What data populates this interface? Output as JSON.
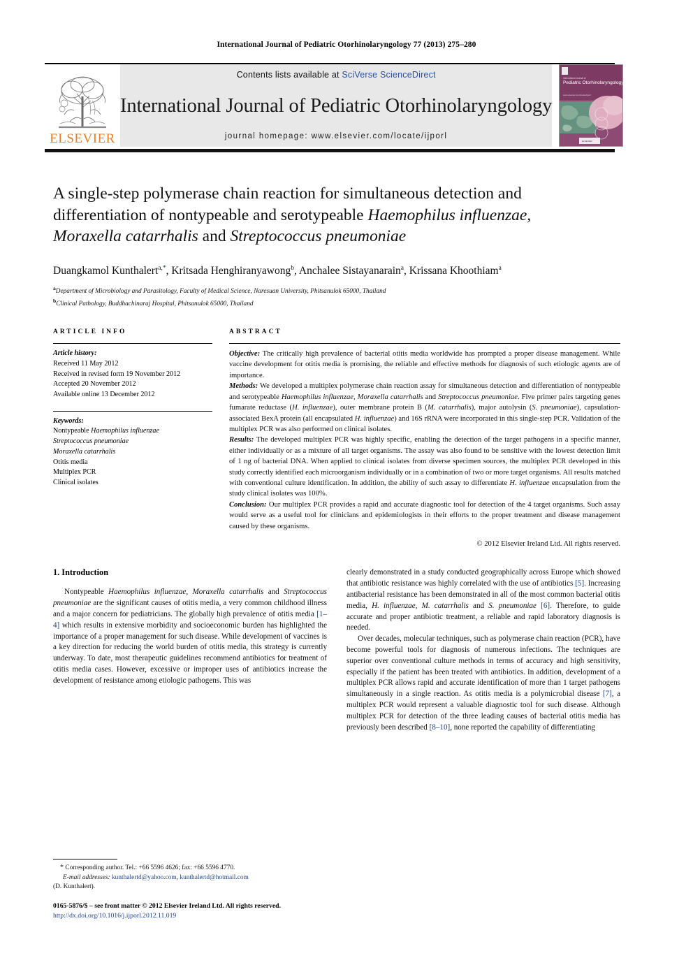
{
  "running_head": "International Journal of Pediatric Otorhinolaryngology 77 (2013) 275–280",
  "masthead": {
    "contents_prefix": "Contents lists available at ",
    "contents_link": "SciVerse ScienceDirect",
    "journal_title": "International Journal of Pediatric Otorhinolaryngology",
    "homepage": "journal homepage: www.elsevier.com/locate/ijporl",
    "publisher": "ELSEVIER",
    "publisher_color": "#ef7d22",
    "cover_title": "Pediatric Otorhinolaryngology",
    "cover_color": "#7d3b63"
  },
  "title": {
    "line1": "A single-step polymerase chain reaction for simultaneous detection and",
    "line2_a": "differentiation of nontypeable and serotypeable ",
    "line2_i": "Haemophilus influenzae,",
    "line3_i1": "Moraxella catarrhalis",
    "line3_a": " and ",
    "line3_i2": "Streptococcus pneumoniae"
  },
  "authors": [
    {
      "name": "Duangkamol Kunthalert",
      "marks": "a,",
      "star": "*"
    },
    {
      "name": "Kritsada Henghiranyawong",
      "marks": "b",
      "star": ""
    },
    {
      "name": "Anchalee Sistayanarain",
      "marks": "a",
      "star": ""
    },
    {
      "name": "Krissana Khoothiam",
      "marks": "a",
      "star": ""
    }
  ],
  "affiliations": [
    {
      "mark": "a",
      "text": "Department of Microbiology and Parasitology, Faculty of Medical Science, Naresuan University, Phitsanulok 65000, Thailand"
    },
    {
      "mark": "b",
      "text": "Clinical Pathology, Buddhachinaraj Hospital, Phitsanulok 65000, Thailand"
    }
  ],
  "panel": {
    "info_heading": "ARTICLE INFO",
    "abstract_heading": "ABSTRACT",
    "history_label": "Article history:",
    "history": [
      "Received 11 May 2012",
      "Received in revised form 19 November 2012",
      "Accepted 20 November 2012",
      "Available online 13 December 2012"
    ],
    "keywords_label": "Keywords:",
    "keywords": [
      "Nontypeable Haemophilus influenzae",
      "Streptococcus pneumoniae",
      "Moraxella catarrhalis",
      "Otitis media",
      "Multiplex PCR",
      "Clinical isolates"
    ]
  },
  "abstract": {
    "objective_label": "Objective:",
    "objective_text": " The critically high prevalence of bacterial otitis media worldwide has prompted a proper disease management. While vaccine development for otitis media is promising, the reliable and effective methods for diagnosis of such etiologic agents are of importance.",
    "methods_label": "Methods:",
    "methods_text": " We developed a multiplex polymerase chain reaction assay for simultaneous detection and differentiation of nontypeable and serotypeable Haemophilus influenzae, Moraxella catarrhalis and Streptococcus pneumoniae. Five primer pairs targeting genes fumarate reductase (H. influenzae), outer membrane protein B (M. catarrhalis), major autolysin (S. pneumoniae), capsulation-associated BexA protein (all encapsulated H. influenzae) and 16S rRNA were incorporated in this single-step PCR. Validation of the multiplex PCR was also performed on clinical isolates.",
    "results_label": "Results:",
    "results_text": " The developed multiplex PCR was highly specific, enabling the detection of the target pathogens in a specific manner, either individually or as a mixture of all target organisms. The assay was also found to be sensitive with the lowest detection limit of 1 ng of bacterial DNA. When applied to clinical isolates from diverse specimen sources, the multiplex PCR developed in this study correctly identified each microorganism individually or in a combination of two or more target organisms. All results matched with conventional culture identification. In addition, the ability of such assay to differentiate H. influenzae encapsulation from the study clinical isolates was 100%.",
    "conclusion_label": "Conclusion:",
    "conclusion_text": " Our multiplex PCR provides a rapid and accurate diagnostic tool for detection of the 4 target organisms. Such assay would serve as a useful tool for clinicians and epidemiologists in their efforts to the proper treatment and disease management caused by these organisms.",
    "copyright": "© 2012 Elsevier Ireland Ltd. All rights reserved."
  },
  "introduction": {
    "heading": "1. Introduction",
    "left_p1_a": "Nontypeable ",
    "left_p1_i1": "Haemophilus influenzae, Moraxella catarrhalis",
    "left_p1_b": " and ",
    "left_p1_i2": "Streptococcus pneumoniae",
    "left_p1_c": " are the significant causes of otitis media, a very common childhood illness and a major concern for pediatricians. The globally high prevalence of otitis media ",
    "left_p1_ref": "[1–4]",
    "left_p1_d": " which results in extensive morbidity and socioeconomic burden has highlighted the importance of a proper management for such disease. While development of vaccines is a key direction for reducing the world burden of otitis media, this strategy is currently underway. To date, most therapeutic guidelines recommend antibiotics for treatment of otitis media cases. However, excessive or improper uses of antibiotics increase the development of resistance among etiologic pathogens. This was",
    "right_p1_a": "clearly demonstrated in a study conducted geographically across Europe which showed that antibiotic resistance was highly correlated with the use of antibiotics ",
    "right_p1_ref1": "[5]",
    "right_p1_b": ". Increasing antibacterial resistance has been demonstrated in all of the most common bacterial otitis media, ",
    "right_p1_i1": "H. influenzae, M. catarrhalis",
    "right_p1_c": " and ",
    "right_p1_i2": "S. pneumoniae",
    "right_p1_ref2": " [6]",
    "right_p1_d": ". Therefore, to guide accurate and proper antibiotic treatment, a reliable and rapid laboratory diagnosis is needed.",
    "right_p2_a": "Over decades, molecular techniques, such as polymerase chain reaction (PCR), have become powerful tools for diagnosis of numerous infections. The techniques are superior over conventional culture methods in terms of accuracy and high sensitivity, especially if the patient has been treated with antibiotics. In addition, development of a multiplex PCR allows rapid and accurate identification of more than 1 target pathogens simultaneously in a single reaction. As otitis media is a polymicrobial disease ",
    "right_p2_ref1": "[7]",
    "right_p2_b": ", a multiplex PCR would represent a valuable diagnostic tool for such disease. Although multiplex PCR for detection of the three leading causes of bacterial otitis media has previously been described ",
    "right_p2_ref2": "[8–10]",
    "right_p2_c": ", none reported the capability of differentiating"
  },
  "footer": {
    "corresponding_star": "*",
    "corresponding_text": " Corresponding author. Tel.: +66 5596 4626; fax: +66 5596 4770.",
    "email_label": "E-mail addresses:",
    "email1": "kunthalertd@yahoo.com",
    "email_sep": ", ",
    "email2": "kunthalertd@hotmail.com",
    "email_owner": "(D. Kunthalert).",
    "imprint": "0165-5876/$ – see front matter © 2012 Elsevier Ireland Ltd. All rights reserved.",
    "doi": "http://dx.doi.org/10.1016/j.ijporl.2012.11.019"
  }
}
